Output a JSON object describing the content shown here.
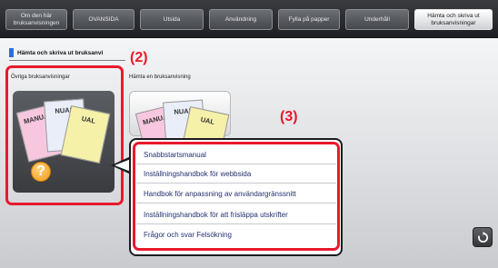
{
  "tabs": [
    {
      "label": "Om den här bruksanvisningen",
      "active": false
    },
    {
      "label": "OVANSIDA",
      "active": false
    },
    {
      "label": "Utsida",
      "active": false
    },
    {
      "label": "Användning",
      "active": false
    },
    {
      "label": "Fylla på papper",
      "active": false
    },
    {
      "label": "Underhåll",
      "active": false
    },
    {
      "label": "Hämta och skriva ut bruksanvisningar",
      "active": true
    }
  ],
  "heading": "Hämta och skriva ut bruksanvi",
  "categories": {
    "other": "Övriga bruksanvisningar",
    "download": "Hämta en bruksanvisning"
  },
  "manual_text": "MANUAL",
  "manual_text_partial_1": "NUAL",
  "manual_text_partial_2": "UAL",
  "question_mark": "?",
  "callouts": {
    "step2": "(2)",
    "step3": "(3)"
  },
  "menu_items": [
    "Snabbstartsmanual",
    "Inställningshandbok för webbsida",
    "Handbok för anpassning av användargränssnitt",
    "Inställningshandbok för att frisläppa utskrifter",
    "Frågor och svar Felsökning"
  ],
  "back_icon": "refresh-icon",
  "colors": {
    "accent_red": "#e8192c",
    "heading_mark": "#2b6fd6",
    "menu_text": "#24306f"
  }
}
